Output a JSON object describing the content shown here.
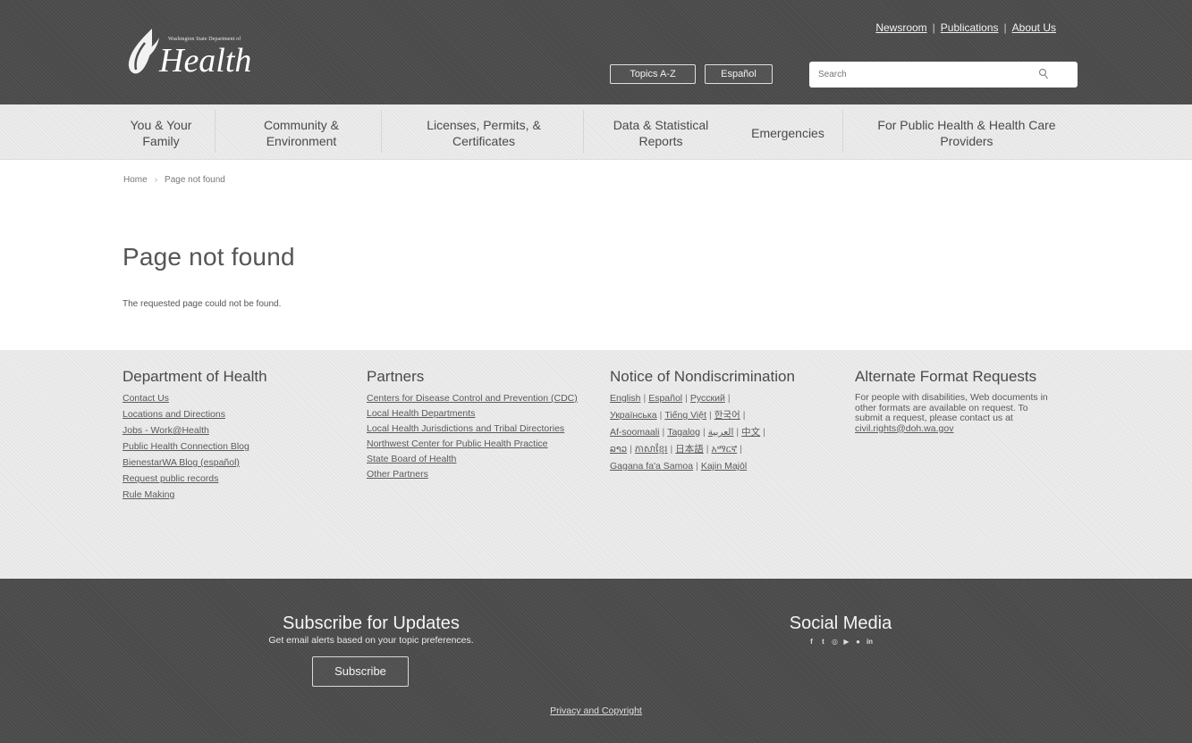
{
  "header": {
    "logo_sub": "Washington State Department of",
    "logo_main": "Health",
    "util_links": [
      "Newsroom",
      "Publications",
      "About Us"
    ],
    "util_sep": "|",
    "topics_button": "Topics A-Z",
    "espanol_button": "Español",
    "search": {
      "placeholder": "Search"
    }
  },
  "nav": {
    "items": [
      {
        "label": "You & Your Family"
      },
      {
        "label": "Community & Environment"
      },
      {
        "label": "Licenses, Permits, & Certificates"
      },
      {
        "label": "Data & Statistical Reports"
      },
      {
        "label": "Emergencies"
      },
      {
        "label": "For Public Health & Health Care Providers"
      }
    ]
  },
  "breadcrumb": {
    "home": "Home",
    "sep": "›",
    "current": "Page not found"
  },
  "main": {
    "title": "Page not found",
    "message": "The requested page could not be found."
  },
  "footer": {
    "doh": {
      "heading": "Department of Health",
      "links": [
        "Contact Us",
        "Locations and Directions",
        "Jobs - Work@Health",
        "Public Health Connection Blog",
        "BienestarWA Blog (español)",
        "Request public records",
        "Rule Making"
      ]
    },
    "partners": {
      "heading": "Partners",
      "links": [
        "Centers for Disease Control and Prevention (CDC)",
        "Local Health Departments",
        "Local Health Jurisdictions and Tribal Directories",
        "Northwest Center for Public Health Practice",
        "State Board of Health",
        "Other Partners"
      ]
    },
    "notice": {
      "heading": "Notice of Nondiscrimination",
      "languages": [
        [
          "English",
          "Español",
          "Русский"
        ],
        [
          "Українська",
          "Tiếng Việt",
          "한국어"
        ],
        [
          "Af-soomaali",
          "Tagalog",
          "العربية",
          "中文"
        ],
        [
          "ລາວ",
          "ភាសាខ្មែរ",
          "日本語",
          "አማርኛ"
        ],
        [
          "Gagana fa'a Samoa",
          "Kajin Majōl"
        ]
      ]
    },
    "alternate": {
      "heading": "Alternate Format Requests",
      "text": "For people with disabilities, Web documents in other formats are available on request. To submit a request, please contact us at ",
      "email": "civil.rights@doh.wa.gov"
    }
  },
  "bottom": {
    "subscribe_heading": "Subscribe for Updates",
    "subscribe_text": "Get email alerts based on your topic preferences.",
    "subscribe_button": "Subscribe",
    "social_heading": "Social Media",
    "social_icons": [
      "facebook-icon",
      "twitter-icon",
      "instagram-icon",
      "youtube-icon",
      "flickr-icon",
      "linkedin-icon"
    ],
    "privacy": "Privacy and Copyright"
  },
  "colors": {
    "header_bg": "#4a4a4a",
    "nav_bg": "#ececec",
    "footer_bg": "#4a4a4a"
  }
}
